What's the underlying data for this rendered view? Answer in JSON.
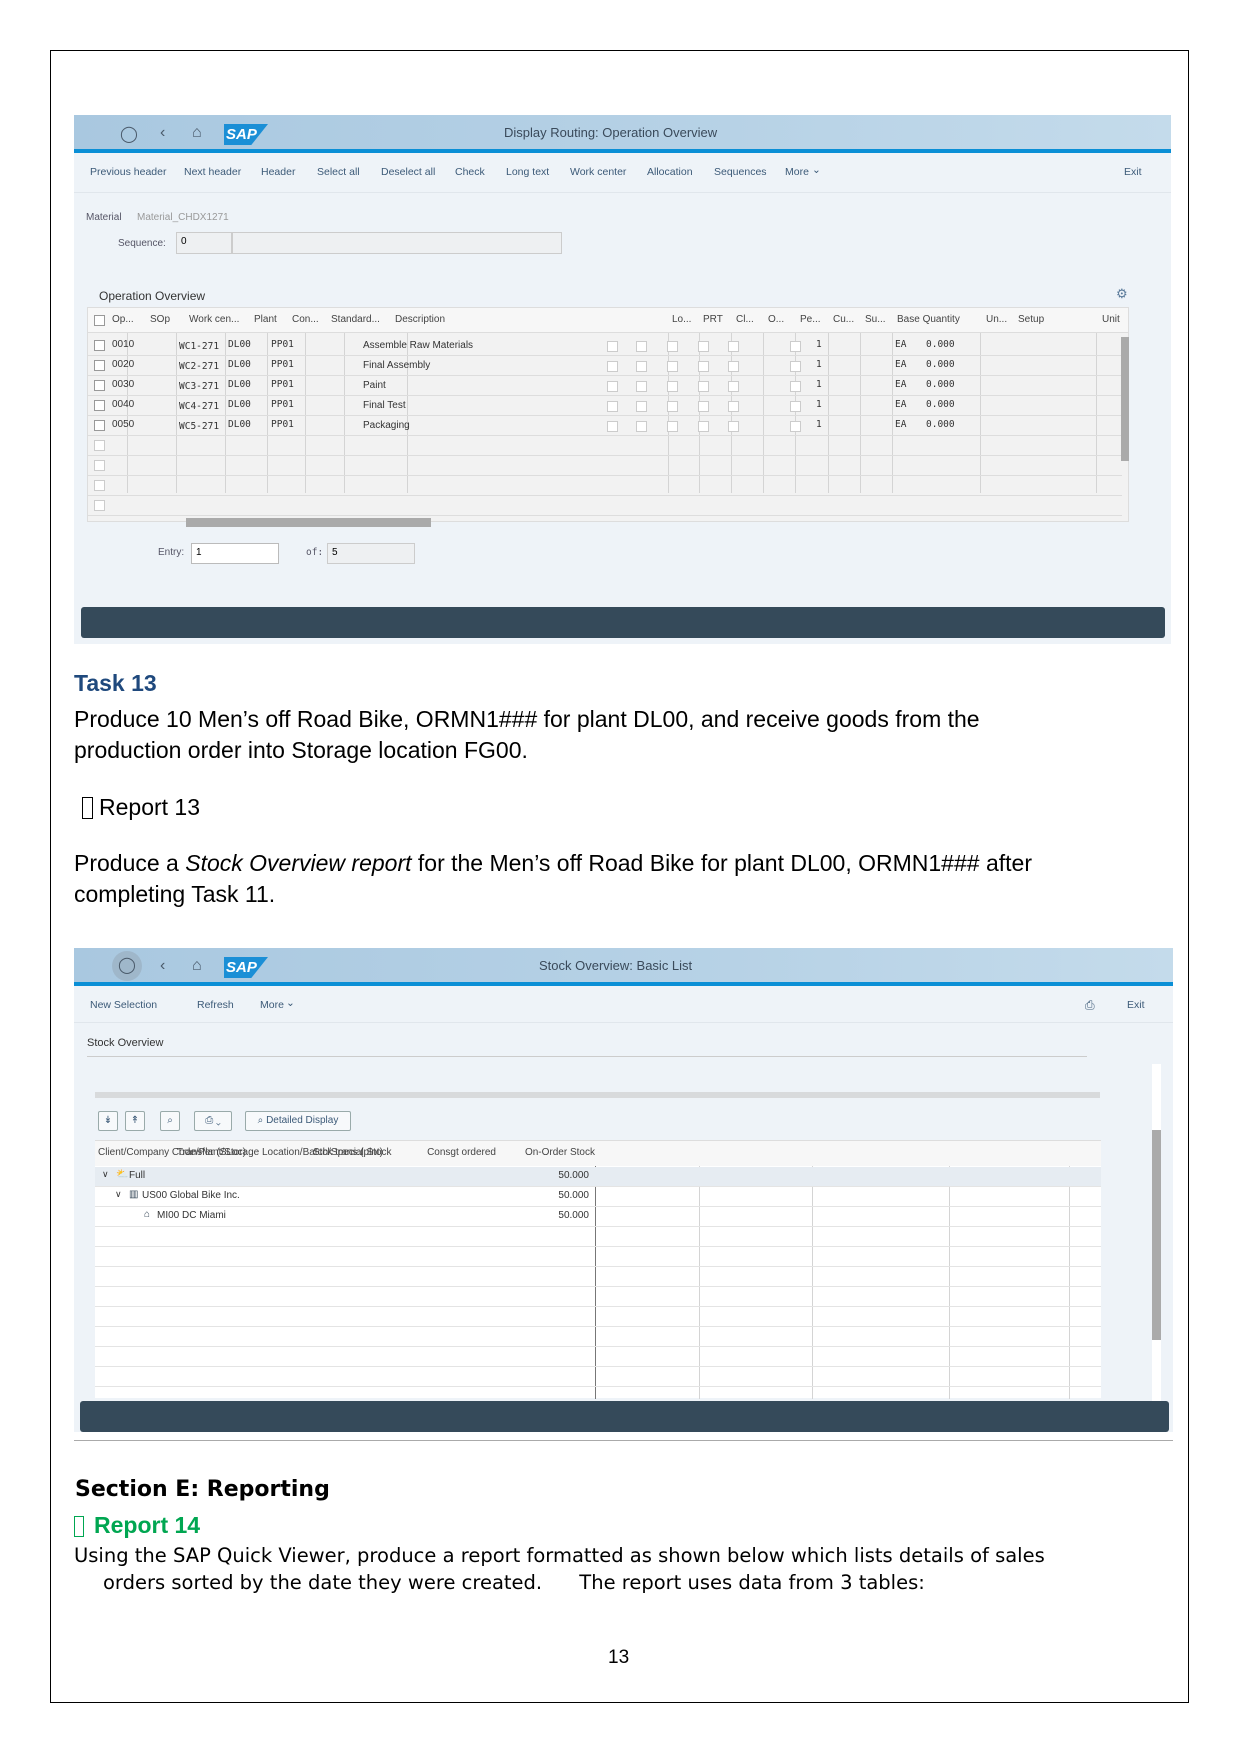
{
  "routing": {
    "title": "Display Routing: Operation Overview",
    "toolbar": [
      "Previous header",
      "Next header",
      "Header",
      "Select all",
      "Deselect all",
      "Check",
      "Long text",
      "Work center",
      "Allocation",
      "Sequences",
      "More"
    ],
    "exit": "Exit",
    "material_label": "Material",
    "material_value": "Material_CHDX1271",
    "sequence_label": "Sequence:",
    "sequence_value": "0",
    "section_title": "Operation Overview",
    "columns": [
      "Op...",
      "SOp",
      "Work cen...",
      "Plant",
      "Con...",
      "Standard...",
      "Description",
      "Lo...",
      "PRT",
      "Cl...",
      "O...",
      "Pe...",
      "Cu...",
      "Su...",
      "Base Quantity",
      "Un...",
      "Setup",
      "Unit"
    ],
    "rows": [
      {
        "op": "0010",
        "wc": "WC1-271",
        "plant": "DL00",
        "con": "PP01",
        "desc": "Assemble Raw Materials",
        "qty": "1",
        "unit": "EA",
        "setup": "0.000"
      },
      {
        "op": "0020",
        "wc": "WC2-271",
        "plant": "DL00",
        "con": "PP01",
        "desc": "Final Assembly",
        "qty": "1",
        "unit": "EA",
        "setup": "0.000"
      },
      {
        "op": "0030",
        "wc": "WC3-271",
        "plant": "DL00",
        "con": "PP01",
        "desc": "Paint",
        "qty": "1",
        "unit": "EA",
        "setup": "0.000"
      },
      {
        "op": "0040",
        "wc": "WC4-271",
        "plant": "DL00",
        "con": "PP01",
        "desc": "Final Test",
        "qty": "1",
        "unit": "EA",
        "setup": "0.000"
      },
      {
        "op": "0050",
        "wc": "WC5-271",
        "plant": "DL00",
        "con": "PP01",
        "desc": "Packaging",
        "qty": "1",
        "unit": "EA",
        "setup": "0.000"
      }
    ],
    "entry_label": "Entry:",
    "entry_value": "1",
    "of_label": "of:",
    "of_value": "5"
  },
  "task13": {
    "heading": "Task 13",
    "line1": "Produce 10 Men’s off Road Bike, ORMN1### for plant DL00, and receive goods from the",
    "line2": "production order into Storage location FG00.",
    "report_bullet": "",
    "report_label": "Report 13",
    "p2_a": "Produce a ",
    "p2_italic": "Stock Overview report",
    "p2_b": " for the Men’s off Road Bike for plant DL00, ORMN1### after",
    "p2_line2": "completing Task 11."
  },
  "stock": {
    "title": "Stock Overview: Basic List",
    "toolbar": [
      "New Selection",
      "Refresh",
      "More"
    ],
    "exit": "Exit",
    "section_title": "Stock Overview",
    "detailed_display": "Detailed Display",
    "columns": [
      "Client/Company Code/Plant/Storage Location/Batch/Special Stock",
      "On-Order Stock",
      "Consgt ordered",
      "Stck trans.(plnt)",
      "Transfer (SLoc)"
    ],
    "rows": [
      {
        "label": "Full",
        "value": "50.000"
      },
      {
        "label": "US00 Global Bike Inc.",
        "value": "50.000"
      },
      {
        "label": "MI00 DC Miami",
        "value": "50.000"
      }
    ]
  },
  "sectionE": {
    "heading": "Section E: Reporting",
    "report_bullet": "",
    "report_label": "Report 14",
    "line1": "Using the SAP Quick Viewer, produce a report formatted as shown below which lists details of sales",
    "line2": "orders sorted by the date they were created.      The report uses data from 3 tables:",
    "accent": "#00a651"
  },
  "page_number": "13",
  "colors": {
    "heading_blue": "#1f497d",
    "sap_blue": "#0a8fd6",
    "dark_bar": "#354a5a"
  }
}
